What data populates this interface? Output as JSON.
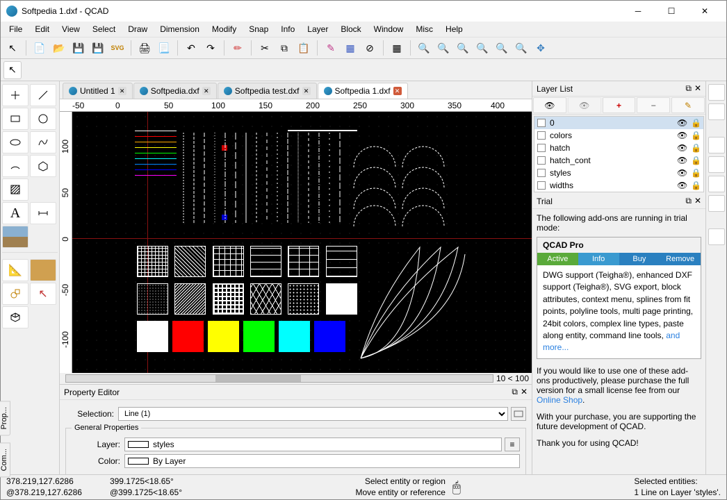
{
  "title": "Softpedia 1.dxf - QCAD",
  "menu": [
    "File",
    "Edit",
    "View",
    "Select",
    "Draw",
    "Dimension",
    "Modify",
    "Snap",
    "Info",
    "Layer",
    "Block",
    "Window",
    "Misc",
    "Help"
  ],
  "tabs": [
    {
      "label": "Untitled 1",
      "active": false
    },
    {
      "label": "Softpedia.dxf",
      "active": false
    },
    {
      "label": "Softpedia test.dxf",
      "active": false
    },
    {
      "label": "Softpedia 1.dxf",
      "active": true
    }
  ],
  "hruler": [
    "-50",
    "0",
    "50",
    "100",
    "150",
    "200",
    "250",
    "300",
    "350",
    "400"
  ],
  "vruler": [
    "100",
    "50",
    "0",
    "-50",
    "-100"
  ],
  "zoom_label": "10 < 100",
  "layer_panel_title": "Layer List",
  "layers": [
    {
      "name": "0",
      "selected": true
    },
    {
      "name": "colors",
      "selected": false
    },
    {
      "name": "hatch",
      "selected": false
    },
    {
      "name": "hatch_cont",
      "selected": false
    },
    {
      "name": "styles",
      "selected": false
    },
    {
      "name": "widths",
      "selected": false
    }
  ],
  "trial_panel_title": "Trial",
  "trial_intro": "The following add-ons are running in trial mode:",
  "addon": {
    "name": "QCAD Pro",
    "btns": {
      "active": "Active",
      "info": "Info",
      "buy": "Buy",
      "remove": "Remove"
    },
    "desc": "DWG support (Teigha®), enhanced DXF support (Teigha®), SVG export, block attributes, context menu, splines from fit points, polyline tools, multi page printing, 24bit colors, complex line types, paste along entity, command line tools, ",
    "more": "and more..."
  },
  "trial_text1a": "If you would like to use one of these add-ons productively, please purchase the full version for a small license fee from our ",
  "trial_link": "Online Shop",
  "trial_text1b": ".",
  "trial_text2": "With your purchase, you are supporting the future development of QCAD.",
  "trial_text3": "Thank you for using QCAD!",
  "property_editor": {
    "title": "Property Editor",
    "selection_label": "Selection:",
    "selection_value": "Line (1)",
    "group": "General Properties",
    "layer_label": "Layer:",
    "layer_value": "styles",
    "color_label": "Color:",
    "color_value": "By Layer"
  },
  "vtabs": {
    "prop": "Prop...",
    "com": "Com..."
  },
  "status": {
    "abs": "378.219,127.6286",
    "rel": "@378.219,127.6286",
    "polar1": "399.1725<18.65°",
    "polar2": "@399.1725<18.65°",
    "hint1": "Select entity or region",
    "hint2": "Move entity or reference",
    "sel1": "Selected entities:",
    "sel2": "1 Line on Layer 'styles'."
  },
  "sample_colors": [
    "#fff",
    "#f00",
    "#fa0",
    "#ff0",
    "#0f0",
    "#0ff",
    "#08f",
    "#00f",
    "#f0f"
  ],
  "swatch_colors": [
    "#ffffff",
    "#ff0000",
    "#ffff00",
    "#00ff00",
    "#00ffff",
    "#0000ff"
  ]
}
